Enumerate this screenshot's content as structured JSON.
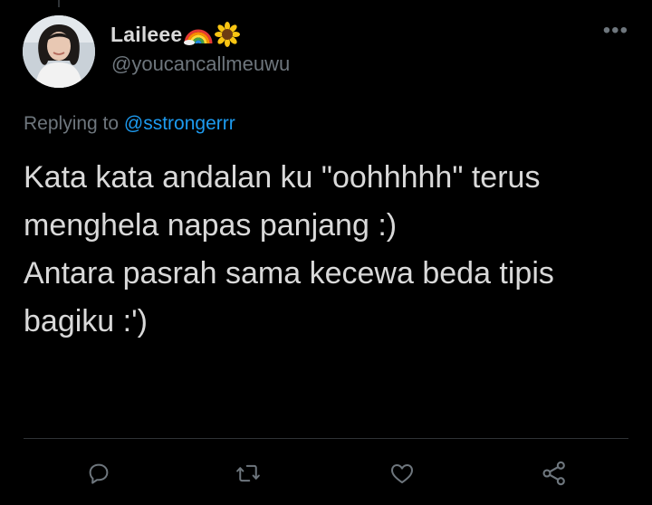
{
  "author": {
    "display_name": "Laileee",
    "emojis": [
      "rainbow-emoji",
      "sunflower-emoji"
    ],
    "handle": "@youcancallmeuwu"
  },
  "reply": {
    "prefix": "Replying to",
    "mention": "@sstrongerrr"
  },
  "tweet": {
    "lines": [
      "Kata kata andalan ku \"oohhhhh\" terus",
      "menghela napas panjang :)",
      "Antara pasrah sama kecewa beda tipis",
      "bagiku :')"
    ]
  },
  "more_menu": {
    "label": "•••"
  },
  "actions": {
    "icons": [
      "reply-icon",
      "retweet-icon",
      "like-icon",
      "share-icon"
    ],
    "color": "#6e767d"
  },
  "colors": {
    "background": "#000000",
    "text": "#d9d9d9",
    "secondary": "#6e767d",
    "link": "#1d9bf0"
  }
}
